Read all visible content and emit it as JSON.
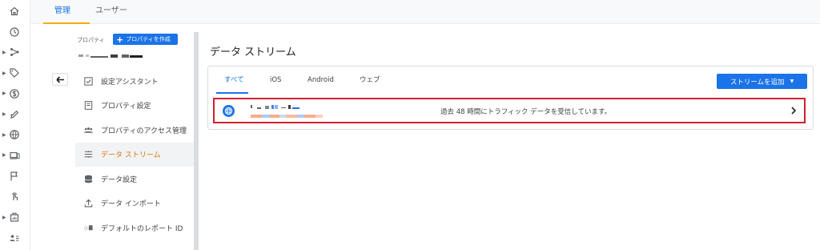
{
  "top_tabs": [
    {
      "label": "管理",
      "active": true
    },
    {
      "label": "ユーザー",
      "active": false
    }
  ],
  "rail_icons": [
    {
      "name": "home-icon",
      "arrow": false
    },
    {
      "name": "clock-icon",
      "arrow": false
    },
    {
      "name": "share-icon",
      "arrow": true
    },
    {
      "name": "tag-icon",
      "arrow": true
    },
    {
      "name": "dollar-icon",
      "arrow": true
    },
    {
      "name": "pencil-icon",
      "arrow": true
    },
    {
      "name": "globe-icon",
      "arrow": true
    },
    {
      "name": "devices-icon",
      "arrow": true
    },
    {
      "name": "flag-icon",
      "arrow": false
    },
    {
      "name": "touch-icon",
      "arrow": false
    },
    {
      "name": "report-icon",
      "arrow": true
    },
    {
      "name": "person-list-icon",
      "arrow": false
    }
  ],
  "property": {
    "label": "プロパティ",
    "create_label": "プロパティを作成"
  },
  "menu_items": [
    {
      "label": "設定アシスタント",
      "icon": "checklist-icon",
      "active": false
    },
    {
      "label": "プロパティ設定",
      "icon": "document-icon",
      "active": false
    },
    {
      "label": "プロパティのアクセス管理",
      "icon": "people-icon",
      "active": false
    },
    {
      "label": "データ ストリーム",
      "icon": "streams-icon",
      "active": true
    },
    {
      "label": "データ設定",
      "icon": "database-icon",
      "active": false
    },
    {
      "label": "データ インポート",
      "icon": "upload-icon",
      "active": false
    },
    {
      "label": "デフォルトのレポート ID",
      "icon": "id-icon",
      "active": false
    }
  ],
  "main": {
    "title": "データ ストリーム",
    "tabs": [
      {
        "label": "すべて",
        "active": true
      },
      {
        "label": "iOS",
        "active": false
      },
      {
        "label": "Android",
        "active": false
      },
      {
        "label": "ウェブ",
        "active": false
      }
    ],
    "add_stream_label": "ストリームを追加",
    "stream": {
      "status": "過去 48 時間にトラフィック データを受信しています。"
    }
  },
  "colors": {
    "accent": "#1a73e8",
    "active_menu": "#e8710a",
    "top_indicator": "#f9ab00",
    "highlight_border": "#d1202f"
  }
}
